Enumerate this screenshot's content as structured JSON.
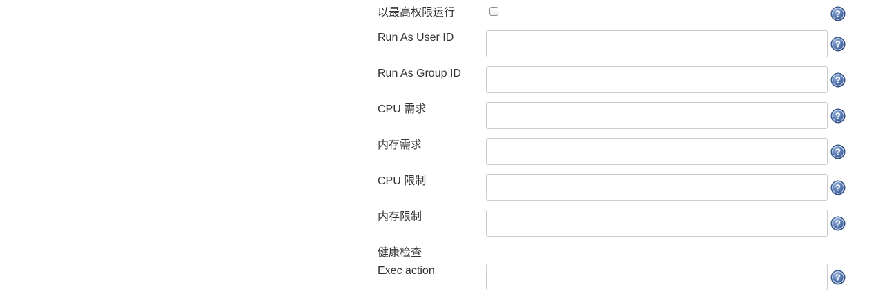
{
  "form": {
    "run_privileged": {
      "label": "以最高权限运行",
      "checked": false
    },
    "run_as_user_id": {
      "label": "Run As User ID",
      "value": ""
    },
    "run_as_group_id": {
      "label": "Run As Group ID",
      "value": ""
    },
    "cpu_request": {
      "label": "CPU 需求",
      "value": ""
    },
    "memory_request": {
      "label": "内存需求",
      "value": ""
    },
    "cpu_limit": {
      "label": "CPU 限制",
      "value": ""
    },
    "memory_limit": {
      "label": "内存限制",
      "value": ""
    },
    "health_check": {
      "section_label": "健康检查"
    },
    "exec_action": {
      "label": "Exec action",
      "value": ""
    }
  },
  "icons": {
    "help": "help-icon",
    "help_color": "#4a6fa5"
  }
}
